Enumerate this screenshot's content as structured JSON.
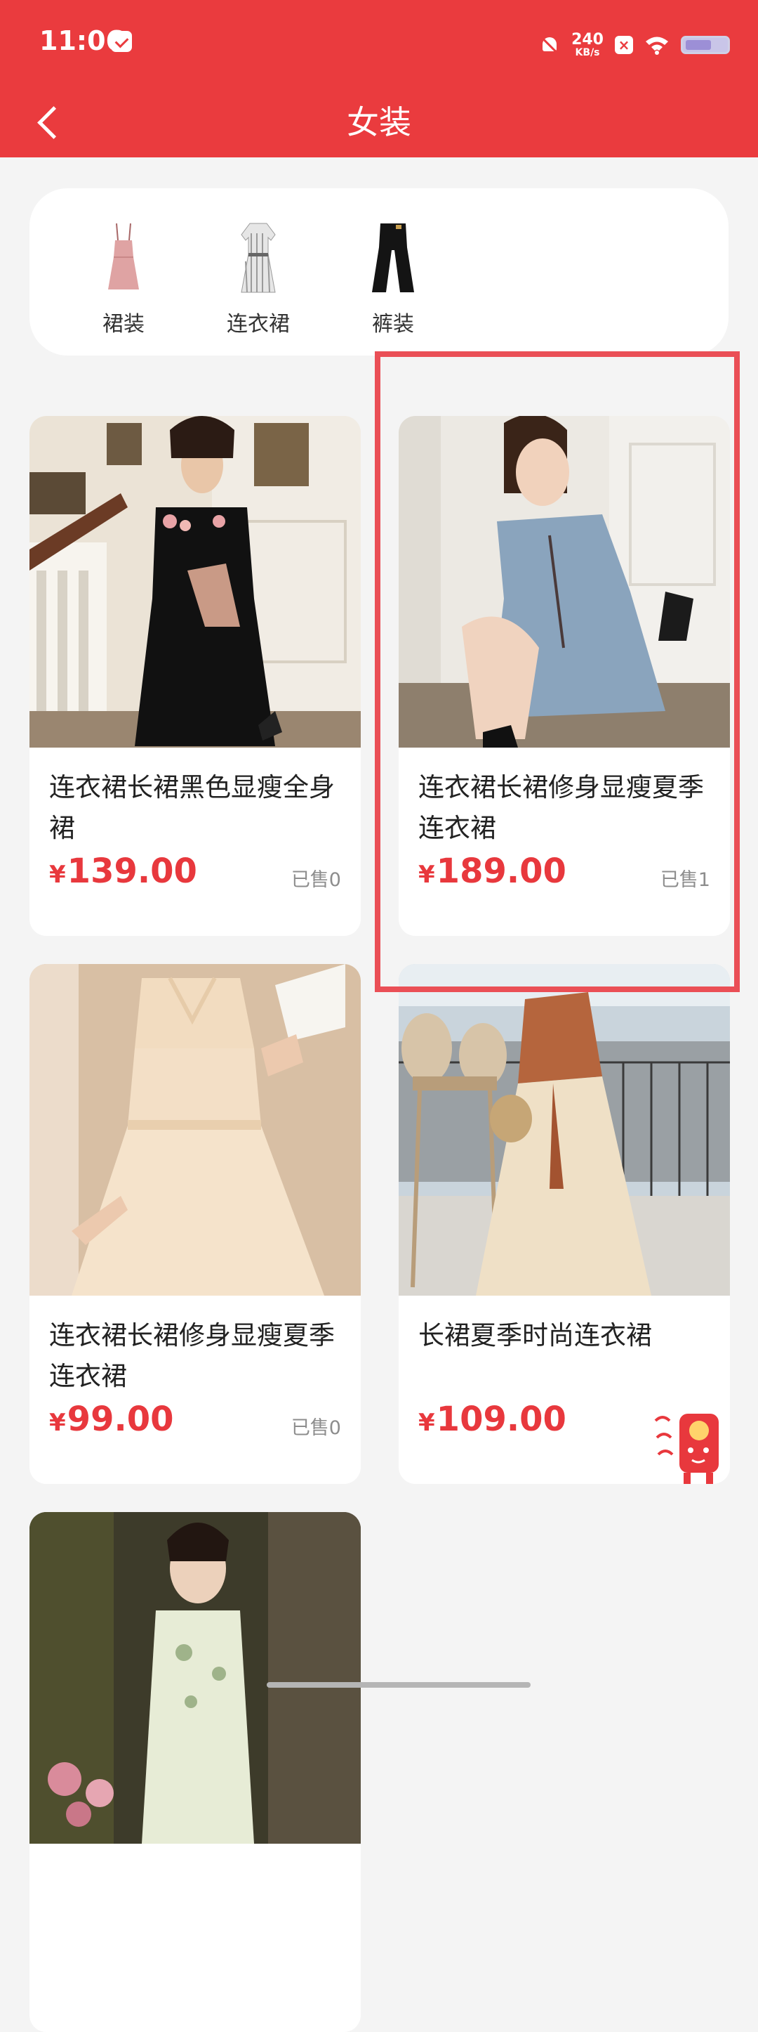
{
  "status_bar": {
    "time": "11:06",
    "net_speed_value": "240",
    "net_speed_unit": "KB/s"
  },
  "header": {
    "title": "女装"
  },
  "categories": [
    {
      "label": "裙装",
      "icon": "dress-icon"
    },
    {
      "label": "连衣裙",
      "icon": "shirt-dress-icon"
    },
    {
      "label": "裤装",
      "icon": "pants-icon"
    }
  ],
  "products": [
    {
      "title": "连衣裙长裙黑色显瘦全身裙",
      "currency": "¥",
      "price": "139.00",
      "sold": "已售0"
    },
    {
      "title": "连衣裙长裙修身显瘦夏季连衣裙",
      "currency": "¥",
      "price": "189.00",
      "sold": "已售1"
    },
    {
      "title": "连衣裙长裙修身显瘦夏季连衣裙",
      "currency": "¥",
      "price": "99.00",
      "sold": "已售0"
    },
    {
      "title": "长裙夏季时尚连衣裙",
      "currency": "¥",
      "price": "109.00",
      "sold": ""
    },
    {
      "title": "",
      "currency": "",
      "price": "",
      "sold": ""
    }
  ],
  "colors": {
    "brand_red": "#ea3b3e",
    "price_red": "#e8383d",
    "highlight_border": "#ea4f56"
  }
}
